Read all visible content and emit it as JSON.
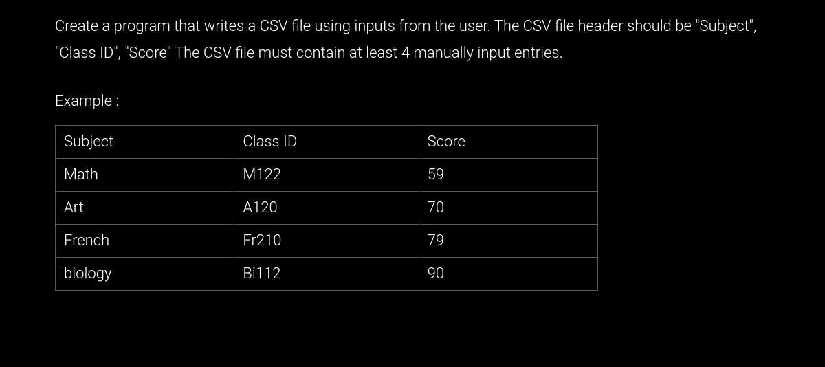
{
  "instruction": "Create a program that writes a CSV file using inputs from the user. The CSV file header should be \"Subject\", \"Class ID\", \"Score\" The CSV file must contain at least 4 manually input entries.",
  "example_label": "Example :",
  "table": {
    "headers": [
      "Subject",
      "Class ID",
      "Score"
    ],
    "rows": [
      [
        "Math",
        "M122",
        "59"
      ],
      [
        "Art",
        "A120",
        "70"
      ],
      [
        "French",
        "Fr210",
        "79"
      ],
      [
        "biology",
        "Bi112",
        "90"
      ]
    ]
  }
}
